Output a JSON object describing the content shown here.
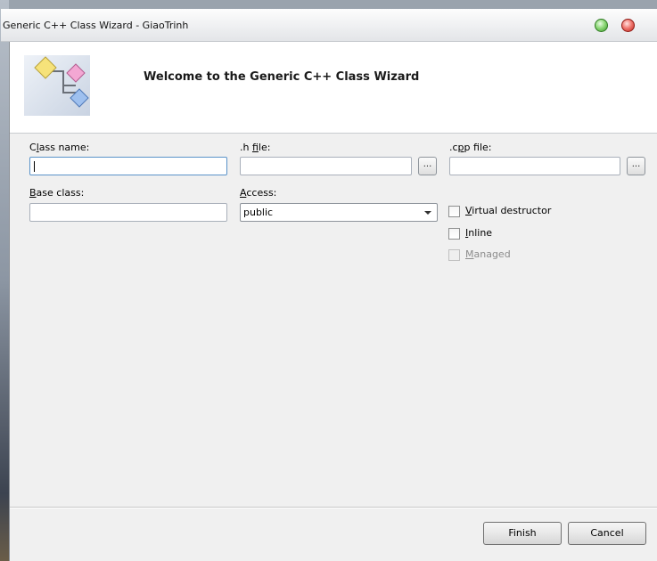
{
  "window": {
    "title": "Generic C++ Class Wizard - GiaoTrinh",
    "welcome": "Welcome to the Generic C++ Class Wizard"
  },
  "fields": {
    "class_name": {
      "label_pre": "C",
      "label_key": "l",
      "label_post": "ass name:",
      "value": ""
    },
    "h_file": {
      "label_pre": ".h ",
      "label_key": "f",
      "label_post": "ile:",
      "value": ""
    },
    "cpp_file": {
      "label_pre": ".c",
      "label_key": "p",
      "label_post": "p file:",
      "value": ""
    },
    "base_class": {
      "label_pre": "",
      "label_key": "B",
      "label_post": "ase class:",
      "value": ""
    },
    "access": {
      "label_pre": "",
      "label_key": "A",
      "label_post": "ccess:",
      "value": "public"
    },
    "browse_label": "..."
  },
  "options": {
    "virtual_destructor": {
      "key": "V",
      "rest": "irtual destructor",
      "checked": false
    },
    "inline": {
      "key": "I",
      "rest": "nline",
      "checked": false
    },
    "managed": {
      "key": "M",
      "rest": "anaged",
      "checked": false,
      "disabled": true
    }
  },
  "buttons": {
    "finish": "Finish",
    "cancel": "Cancel"
  },
  "icons": {
    "logo": "class-wizard-logo-icon",
    "minimize": "green-circle-icon",
    "close": "red-circle-icon"
  }
}
